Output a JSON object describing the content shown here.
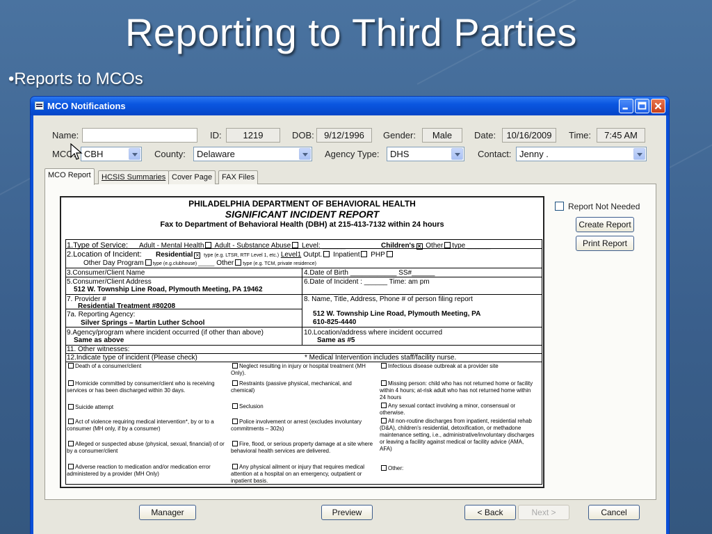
{
  "slide": {
    "title": "Reporting to Third Parties",
    "bullet": "•Reports to MCOs"
  },
  "window": {
    "title": "MCO Notifications"
  },
  "header": {
    "name_label": "Name:",
    "name_value": "",
    "id_label": "ID:",
    "id_value": "1219",
    "dob_label": "DOB:",
    "dob_value": "9/12/1996",
    "gender_label": "Gender:",
    "gender_value": "Male",
    "date_label": "Date:",
    "date_value": "10/16/2009",
    "time_label": "Time:",
    "time_value": "7:45 AM",
    "mco_label": "MCO:",
    "mco_value": "CBH",
    "county_label": "County:",
    "county_value": "Delaware",
    "agency_type_label": "Agency Type:",
    "agency_type_value": "DHS",
    "contact_label": "Contact:",
    "contact_value": "Jenny ."
  },
  "tabs": [
    "MCO Report",
    "HCSIS Summaries",
    "Cover Page",
    "FAX Files"
  ],
  "document": {
    "dept": "PHILADELPHIA DEPARTMENT OF BEHAVIORAL HEALTH",
    "report": "SIGNIFICANT INCIDENT REPORT",
    "fax": "Fax to Department of Behavioral Health (DBH) at 215-413-7132 within 24 hours",
    "r1a": "1.Type of Service:",
    "r1b": "Adult - Mental Health",
    "r1c": "Adult - Substance Abuse",
    "r1d": "Level: ______",
    "r1e": "Children's",
    "r1f": "Other",
    "r1g": "type ______",
    "r2a": "2.Location of Incident:",
    "r2b": "Residential",
    "r2c": "type (e.g. LTSR, RTF Level 1, etc.)",
    "r2d": "Level1",
    "r2e": "Outpt.",
    "r2f": "Inpatient",
    "r2g": "PHP",
    "r2h": "Other Day Program",
    "r2i": "type (e.g.clubhouse) ______",
    "r2j": "Other",
    "r2k": "type (e.g. TCM, private residence)",
    "r3a": "3.Consumer/Client Name",
    "r3b": "4.Date of Birth ____________ SS#______",
    "r5a": "5.Consumer/Client Address",
    "r5b": "512 W. Township Line Road, Plymouth Meeting, PA 19462",
    "r6": "6.Date of Incident : ______      Time:        am          pm",
    "r7a": "7.  Provider #",
    "r7b": "Residential Treatment         #80208",
    "r8": "8. Name, Title, Address, Phone # of person filing report",
    "r7c": "7a. Reporting Agency:",
    "r7d": "Silver Springs – Martin Luther School",
    "r8b": "512 W. Township Line Road, Plymouth Meeting, PA",
    "r8c": "610-825-4440",
    "r9a": "9.Agency/program where incident occurred (if other than above)",
    "r9b": "Same as above",
    "r10a": "10.Location/address where incident occurred",
    "r10b": "Same as #5",
    "r11": "11. Other witnesses:",
    "r12": "12.Indicate type of incident (Please check)",
    "r12b": "* Medical Intervention includes staff/facility nurse.",
    "incidents": {
      "c1": [
        "Death of a consumer/client",
        "Homicide committed by consumer/client who is receiving services or has been discharged within 30 days.",
        "Suicide attempt",
        "Act of violence requiring medical intervention*, by or to a consumer (MH only, if by a consumer)",
        "Alleged or suspected abuse (physical, sexual, financial) of or by a consumer/client",
        "Adverse reaction to medication and/or medication error administered by a provider (MH Only)"
      ],
      "c2": [
        "Neglect resulting in injury or hospital treatment (MH Only).",
        "Restraints (passive physical, mechanical, and chemical)",
        "Seclusion",
        "Police involvement or arrest (excludes involuntary commitments – 302s)",
        "Fire, flood, or serious property damage at a site where behavioral health services are delivered.",
        "Any physical ailment or injury that requires medical attention at a hospital on an emergency, outpatient or inpatient basis."
      ],
      "c3": [
        "Infectious disease outbreak at a provider site",
        "Missing person: child who has not returned home or facility within 4 hours; at-risk adult who has not returned home within 24 hours",
        "Any sexual contact involving a minor, consensual or otherwise.",
        "All non-routine discharges from inpatient, residential rehab (D&A), children's residential, detoxification, or methadone maintenance setting, i.e., administrative/involuntary discharges or leaving a facility against medical or facility advice (AMA, AFA)",
        "Other:"
      ]
    }
  },
  "side": {
    "report_not_needed": "Report Not Needed",
    "create_report": "Create Report",
    "print_report": "Print Report"
  },
  "footer": {
    "manager": "Manager",
    "preview": "Preview",
    "back": "< Back",
    "next": "Next >",
    "cancel": "Cancel"
  }
}
